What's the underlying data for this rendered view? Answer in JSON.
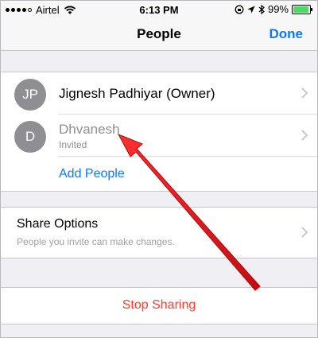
{
  "status_bar": {
    "carrier": "Airtel",
    "time": "6:13 PM",
    "battery_percent": "99%",
    "battery_level": 0.99,
    "icons": [
      "wifi-icon",
      "lock-rotation-icon",
      "location-icon",
      "bluetooth-icon",
      "battery-icon"
    ]
  },
  "nav": {
    "title": "People",
    "done_label": "Done"
  },
  "people": [
    {
      "initials": "JP",
      "name": "Jignesh Padhiyar (Owner)",
      "status": ""
    },
    {
      "initials": "D",
      "name": "Dhvanesh",
      "status": "Invited"
    }
  ],
  "add_people_label": "Add People",
  "share_options": {
    "title": "Share Options",
    "subtitle": "People you invite can make changes."
  },
  "stop_sharing_label": "Stop Sharing",
  "colors": {
    "accent": "#0a7aff",
    "destructive": "#ff3b30",
    "annotation_arrow": "#e8141a"
  }
}
